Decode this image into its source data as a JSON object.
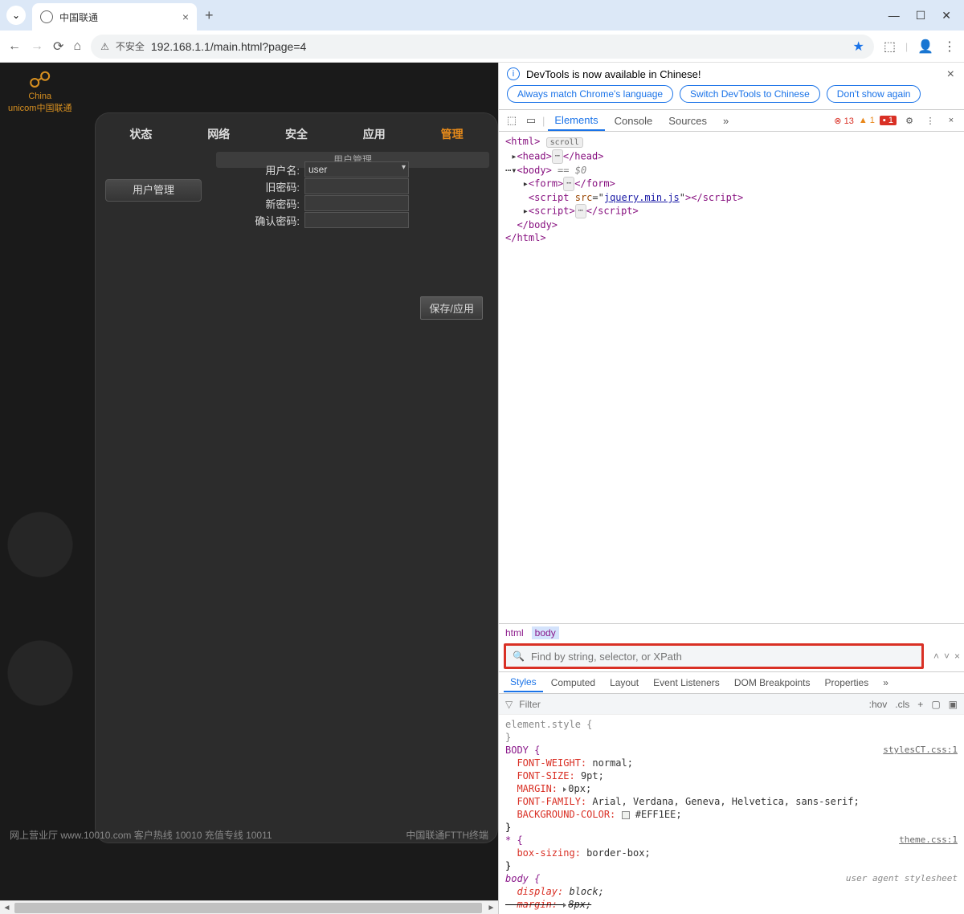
{
  "browser": {
    "tab_title": "中国联通",
    "insecure_label": "不安全",
    "url": "192.168.1.1/main.html?page=4"
  },
  "logo": {
    "line1": "China",
    "line2": "unicom中国联通"
  },
  "nav": {
    "tabs": [
      "状态",
      "网络",
      "安全",
      "应用",
      "管理"
    ],
    "subnav": "用户管理",
    "sidebar_button": "用户管理"
  },
  "form": {
    "username_label": "用户名:",
    "username_value": "user",
    "oldpw_label": "旧密码:",
    "newpw_label": "新密码:",
    "confirmpw_label": "确认密码:",
    "save_label": "保存/应用"
  },
  "footer": {
    "left": "网上营业厅 www.10010.com 客户热线 10010 充值专线 10011",
    "right": "中国联通FTTH终端"
  },
  "devtools": {
    "info_text": "DevTools is now available in Chinese!",
    "chips": [
      "Always match Chrome's language",
      "Switch DevTools to Chinese",
      "Don't show again"
    ],
    "tabs": [
      "Elements",
      "Console",
      "Sources"
    ],
    "badges": {
      "errors": "13",
      "warnings": "1",
      "info": "1"
    },
    "dom": {
      "html": "html",
      "scroll": "scroll",
      "head_open": "head",
      "body": "body",
      "eq0": "== $0",
      "form": "form",
      "script_attr": "script src=",
      "jquery": "jquery.min.js",
      "script": "script"
    },
    "breadcrumb": [
      "html",
      "body"
    ],
    "search_placeholder": "Find by string, selector, or XPath",
    "styles_tabs": [
      "Styles",
      "Computed",
      "Layout",
      "Event Listeners",
      "DOM Breakpoints",
      "Properties"
    ],
    "filter_placeholder": "Filter",
    "filter_icons": [
      ":hov",
      ".cls"
    ],
    "rules": {
      "elstyle": "element.style {",
      "body_sel": "BODY {",
      "src1": "stylesCT.css:1",
      "fw": "FONT-WEIGHT:",
      "fw_v": "normal;",
      "fs": "FONT-SIZE:",
      "fs_v": "9pt;",
      "mg": "MARGIN:",
      "mg_v": "0px;",
      "ff": "FONT-FAMILY:",
      "ff_v": "Arial, Verdana, Geneva, Helvetica, sans-serif;",
      "bg": "BACKGROUND-COLOR:",
      "bg_v": "#EFF1EE;",
      "star_sel": "* {",
      "src2": "theme.css:1",
      "bs": "box-sizing:",
      "bs_v": "border-box;",
      "body2": "body {",
      "ua": "user agent stylesheet",
      "disp": "display:",
      "disp_v": "block;",
      "mg2": "margin:",
      "mg2_v": "8px;"
    }
  }
}
